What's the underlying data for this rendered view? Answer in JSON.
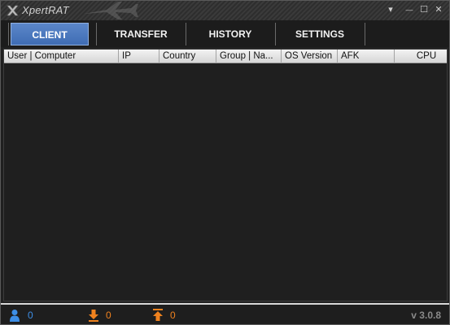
{
  "app": {
    "title": "XpertRAT",
    "version": "v 3.0.8"
  },
  "window_controls": {
    "menu": "▾",
    "minimize": "—",
    "maximize": "☐",
    "close": "✕"
  },
  "tabs": [
    {
      "label": "CLIENT",
      "active": true
    },
    {
      "label": "TRANSFER",
      "active": false
    },
    {
      "label": "HISTORY",
      "active": false
    },
    {
      "label": "SETTINGS",
      "active": false
    }
  ],
  "table": {
    "columns": [
      "User | Computer",
      "IP",
      "Country",
      "Group | Na...",
      "OS Version",
      "AFK",
      "CPU"
    ],
    "rows": []
  },
  "status": {
    "clients": {
      "icon": "user-icon",
      "value": "0",
      "color": "#3d8ee6"
    },
    "downloads": {
      "icon": "download-arrow-icon",
      "value": "0",
      "color": "#f0821e"
    },
    "uploads": {
      "icon": "upload-arrow-icon",
      "value": "0",
      "color": "#f0821e"
    }
  },
  "colors": {
    "accent_tab": "#4a78c0",
    "background": "#202020",
    "status_blue": "#3d8ee6",
    "status_orange": "#f0821e"
  }
}
